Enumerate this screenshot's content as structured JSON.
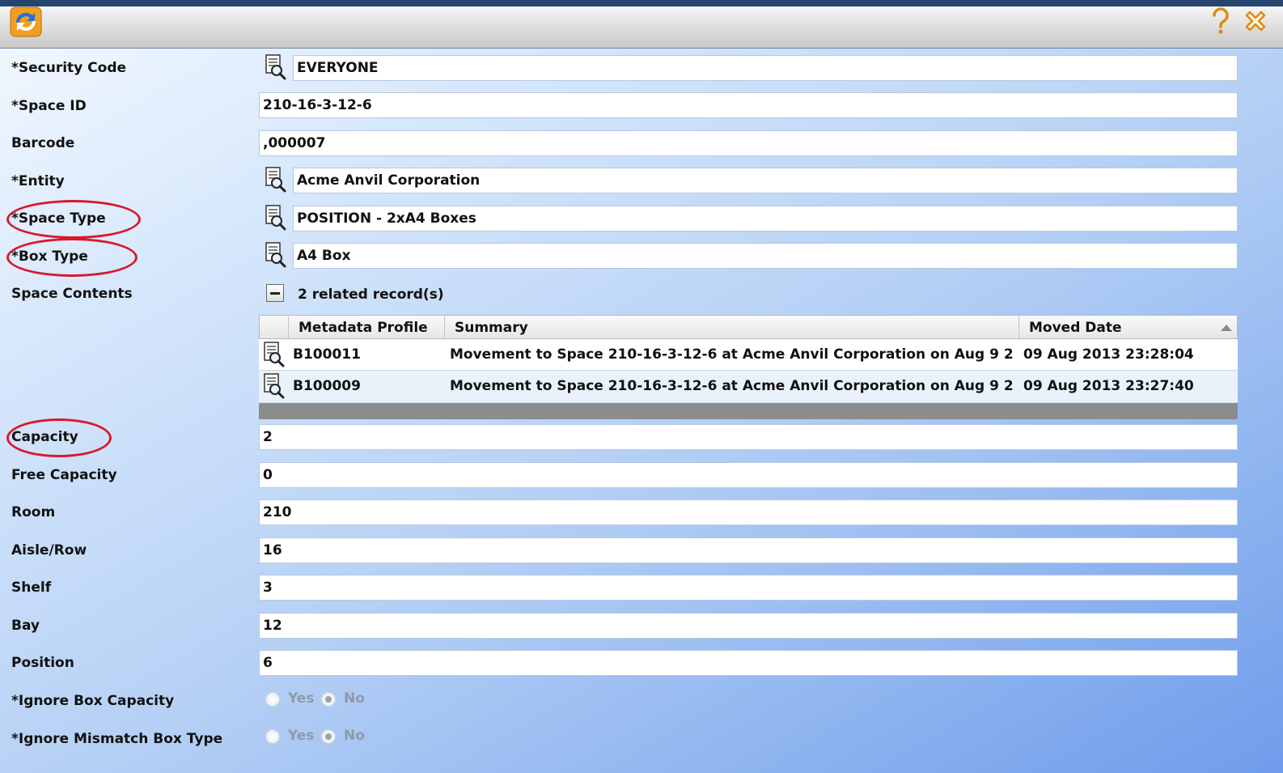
{
  "window": {
    "help_icon": "question-mark-icon",
    "close_icon": "close-x-icon",
    "app_icon": "refresh-app-icon"
  },
  "fields": {
    "security_code": {
      "label": "*Security Code",
      "value": "EVERYONE"
    },
    "space_id": {
      "label": "*Space ID",
      "value": "210-16-3-12-6"
    },
    "barcode": {
      "label": "Barcode",
      "value": ",000007"
    },
    "entity": {
      "label": "*Entity",
      "value": "Acme Anvil Corporation"
    },
    "space_type": {
      "label": "*Space Type",
      "value": "POSITION - 2xA4 Boxes"
    },
    "box_type": {
      "label": "*Box Type",
      "value": "A4 Box"
    },
    "space_contents": {
      "label": "Space Contents",
      "value": "2 related record(s)"
    },
    "capacity": {
      "label": "Capacity",
      "value": "2"
    },
    "free_capacity": {
      "label": "Free Capacity",
      "value": "0"
    },
    "room": {
      "label": "Room",
      "value": "210"
    },
    "aisle_row": {
      "label": "Aisle/Row",
      "value": "16"
    },
    "shelf": {
      "label": "Shelf",
      "value": "3"
    },
    "bay": {
      "label": "Bay",
      "value": "12"
    },
    "position": {
      "label": "Position",
      "value": "6"
    }
  },
  "grid": {
    "headers": {
      "profile": "Metadata Profile",
      "summary": "Summary",
      "moved": "Moved Date"
    },
    "rows": [
      {
        "profile": "B100011",
        "summary": "Movement to Space 210-16-3-12-6 at Acme Anvil Corporation on Aug  9 2013 ...",
        "moved": "09 Aug 2013 23:28:04"
      },
      {
        "profile": "B100009",
        "summary": "Movement to Space 210-16-3-12-6 at Acme Anvil Corporation on Aug  9 2013 ...",
        "moved": "09 Aug 2013 23:27:40"
      }
    ]
  },
  "radios": {
    "ignore_box_capacity": {
      "label": "*Ignore Box Capacity",
      "yes": "Yes",
      "no": "No",
      "selected": "No"
    },
    "ignore_mismatch_box_type": {
      "label": "*Ignore Mismatch Box Type",
      "yes": "Yes",
      "no": "No",
      "selected": "No"
    }
  },
  "colors": {
    "highlight_ring": "#d8192a",
    "title_border": "#25456e"
  }
}
